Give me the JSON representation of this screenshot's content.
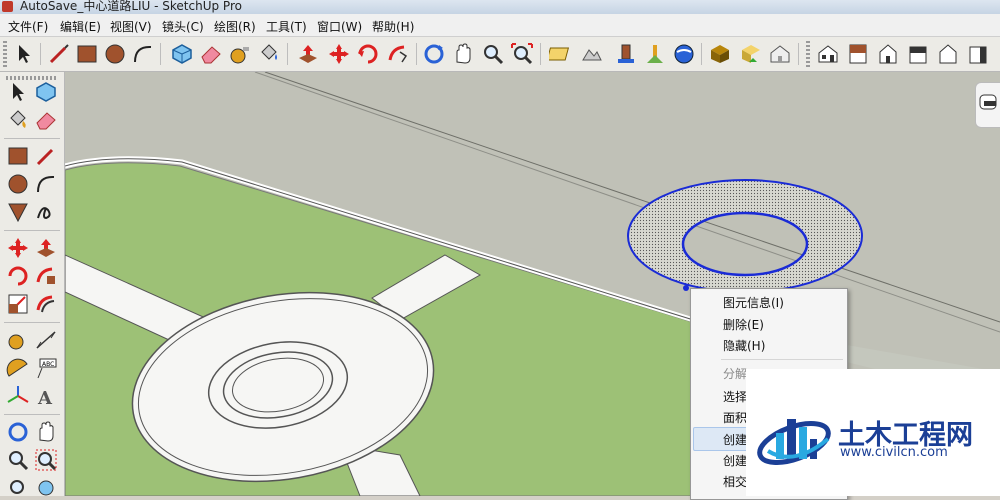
{
  "window": {
    "title": "AutoSave_中心道路LIU - SketchUp Pro"
  },
  "menubar": {
    "items": [
      {
        "label": "文件(F)"
      },
      {
        "label": "编辑(E)"
      },
      {
        "label": "视图(V)"
      },
      {
        "label": "镜头(C)"
      },
      {
        "label": "绘图(R)"
      },
      {
        "label": "工具(T)"
      },
      {
        "label": "窗口(W)"
      },
      {
        "label": "帮助(H)"
      }
    ]
  },
  "toolbar": {
    "icons": [
      "select-icon",
      "pencil-line-icon",
      "rectangle-icon",
      "circle-icon",
      "arc-icon",
      "make-component-icon",
      "eraser-icon",
      "tape-measure-icon",
      "paint-bucket-icon",
      "push-pull-icon",
      "move-icon",
      "rotate-icon",
      "follow-me-icon",
      "orbit-icon",
      "pan-icon",
      "zoom-icon",
      "zoom-extents-icon",
      "add-location-icon",
      "toggle-terrain-icon",
      "preview-google-earth-icon",
      "get-models-icon",
      "share-model-icon",
      "share-component-icon",
      "warehouse-icon",
      "iso-view-icon",
      "top-view-icon",
      "front-view-icon",
      "right-view-icon",
      "back-view-icon",
      "left-view-icon"
    ]
  },
  "sidebar": {
    "icons": [
      "select-icon",
      "make-component-icon",
      "paint-bucket-icon",
      "eraser-icon",
      "rectangle-icon",
      "line-icon",
      "circle-icon",
      "arc-icon",
      "polygon-icon",
      "freehand-icon",
      "move-icon",
      "push-pull-icon",
      "rotate-icon",
      "follow-me-icon",
      "scale-icon",
      "offset-icon",
      "tape-measure-icon",
      "dimension-icon",
      "protractor-icon",
      "text-icon",
      "axes-icon",
      "3d-text-icon",
      "orbit-icon",
      "pan-icon",
      "zoom-icon",
      "zoom-window-icon",
      "zoom-extents-icon",
      "previous-view-icon"
    ]
  },
  "context_menu": {
    "items": [
      {
        "label": "图元信息(I)",
        "enabled": true
      },
      {
        "label": "删除(E)",
        "enabled": true
      },
      {
        "label": "隐藏(H)",
        "enabled": true
      },
      {
        "label": "分解",
        "enabled": false
      },
      {
        "label": "选择",
        "enabled": true
      },
      {
        "label": "面积",
        "enabled": true
      },
      {
        "label": "创建",
        "enabled": true
      },
      {
        "label": "创建",
        "enabled": true
      },
      {
        "label": "相交",
        "enabled": true
      }
    ]
  },
  "watermark": {
    "brand": "土木工程网",
    "url": "www.civilcn.com"
  },
  "colors": {
    "grass": "#9dc176",
    "road": "#c1c2b8",
    "sky": "#c4c7bd",
    "selection": "#1a2bd6"
  }
}
